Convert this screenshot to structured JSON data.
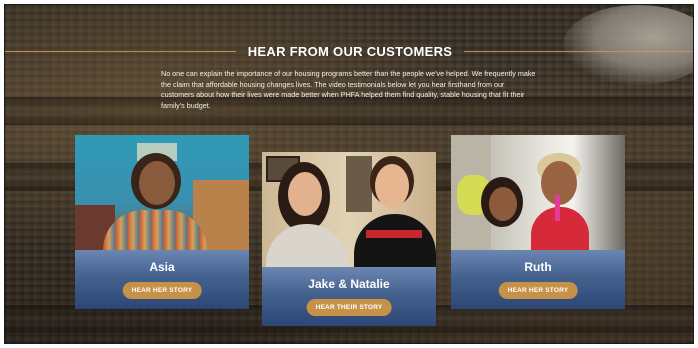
{
  "section": {
    "title": "HEAR FROM OUR CUSTOMERS",
    "intro": "No one can explain the importance of our housing programs better than the people we've helped. We frequently make the claim that affordable housing changes lives. The video testimonials below let you hear firsthand from our customers about how their lives were made better when PHFA helped them find quality, stable housing that fit their family's budget."
  },
  "cards": [
    {
      "name": "Asia",
      "button": "HEAR HER STORY"
    },
    {
      "name": "Jake & Natalie",
      "button": "HEAR THEIR STORY"
    },
    {
      "name": "Ruth",
      "button": "HEAR HER STORY"
    }
  ],
  "colors": {
    "accent_gold": "#c6924a",
    "card_blue": "#45628f",
    "title_line": "#c79a52"
  }
}
